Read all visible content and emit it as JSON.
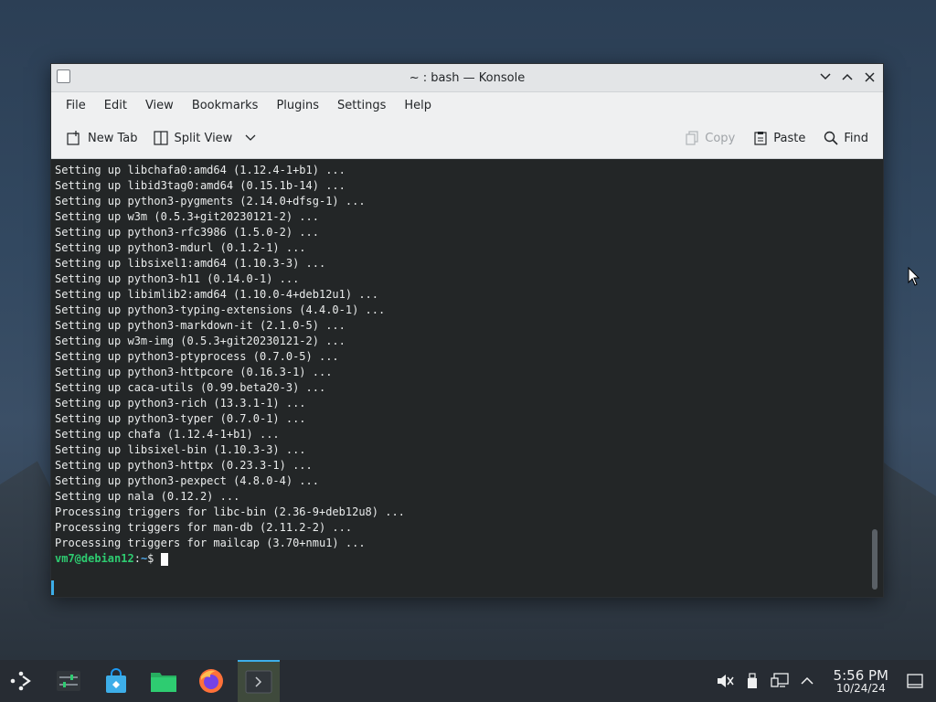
{
  "window": {
    "title": "~ : bash — Konsole"
  },
  "menubar": [
    "File",
    "Edit",
    "View",
    "Bookmarks",
    "Plugins",
    "Settings",
    "Help"
  ],
  "toolbar": {
    "new_tab": "New Tab",
    "split_view": "Split View",
    "copy": "Copy",
    "paste": "Paste",
    "find": "Find"
  },
  "terminal": {
    "lines": [
      "Setting up libchafa0:amd64 (1.12.4-1+b1) ...",
      "Setting up libid3tag0:amd64 (0.15.1b-14) ...",
      "Setting up python3-pygments (2.14.0+dfsg-1) ...",
      "Setting up w3m (0.5.3+git20230121-2) ...",
      "Setting up python3-rfc3986 (1.5.0-2) ...",
      "Setting up python3-mdurl (0.1.2-1) ...",
      "Setting up libsixel1:amd64 (1.10.3-3) ...",
      "Setting up python3-h11 (0.14.0-1) ...",
      "Setting up libimlib2:amd64 (1.10.0-4+deb12u1) ...",
      "Setting up python3-typing-extensions (4.4.0-1) ...",
      "Setting up python3-markdown-it (2.1.0-5) ...",
      "Setting up w3m-img (0.5.3+git20230121-2) ...",
      "Setting up python3-ptyprocess (0.7.0-5) ...",
      "Setting up python3-httpcore (0.16.3-1) ...",
      "Setting up caca-utils (0.99.beta20-3) ...",
      "Setting up python3-rich (13.3.1-1) ...",
      "Setting up python3-typer (0.7.0-1) ...",
      "Setting up chafa (1.12.4-1+b1) ...",
      "Setting up libsixel-bin (1.10.3-3) ...",
      "Setting up python3-httpx (0.23.3-1) ...",
      "Setting up python3-pexpect (4.8.0-4) ...",
      "Setting up nala (0.12.2) ...",
      "Processing triggers for libc-bin (2.36-9+deb12u8) ...",
      "Processing triggers for man-db (2.11.2-2) ...",
      "Processing triggers for mailcap (3.70+nmu1) ..."
    ],
    "prompt_user": "vm7@debian12",
    "prompt_sep": ":",
    "prompt_path": "~",
    "prompt_symbol": "$ "
  },
  "taskbar": {
    "clock_time": "5:56 PM",
    "clock_date": "10/24/24"
  },
  "colors": {
    "terminal_bg": "#232627",
    "prompt_user": "#2ecc71",
    "prompt_path": "#4fa8e8",
    "accent": "#3daee9"
  }
}
